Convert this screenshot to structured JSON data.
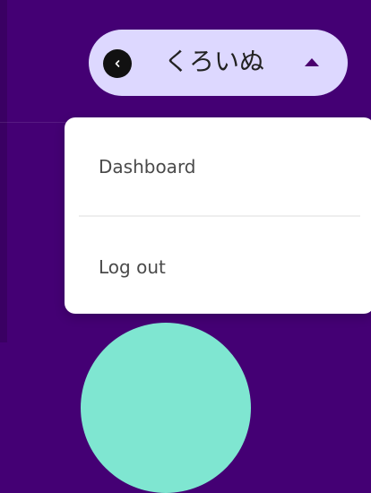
{
  "user_menu": {
    "avatar_icon": "chevron-left-icon",
    "username": "くろいぬ",
    "caret_icon": "caret-up-icon"
  },
  "dropdown": {
    "items": [
      {
        "label": "Dashboard"
      },
      {
        "label": "Log out"
      }
    ]
  },
  "colors": {
    "background": "#440074",
    "pill": "#ddd8ff",
    "menu_background": "#ffffff",
    "accent_circle": "#7fe6d1"
  }
}
